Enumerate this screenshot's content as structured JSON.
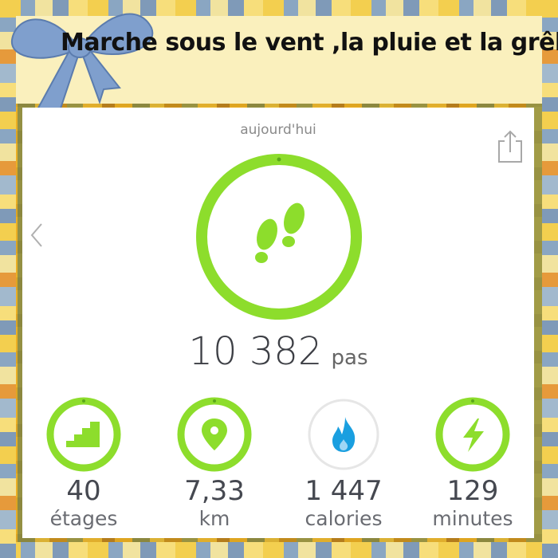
{
  "caption": "Marche sous le vent ,la pluie et la grêle",
  "app": {
    "day_label": "aujourd'hui",
    "steps": {
      "value": "10 382",
      "unit": "pas",
      "icon": "footprints-icon",
      "goal_progress": 1.0
    },
    "stats": [
      {
        "id": "floors",
        "value": "40",
        "label": "étages",
        "icon": "stairs-icon",
        "goal_progress": 1.0
      },
      {
        "id": "distance",
        "value": "7,33",
        "label": "km",
        "icon": "location-pin-icon",
        "goal_progress": 1.0
      },
      {
        "id": "calories",
        "value": "1 447",
        "label": "calories",
        "icon": "flame-icon",
        "goal_progress": 0.0
      },
      {
        "id": "active-minutes",
        "value": "129",
        "label": "minutes",
        "icon": "lightning-icon",
        "goal_progress": 1.0
      }
    ]
  },
  "colors": {
    "accent_green": "#8ddd2c",
    "flame_blue": "#1a9fe0",
    "ring_grey": "#e6e6e6",
    "ribbon_blue": "#7f9fcd"
  }
}
